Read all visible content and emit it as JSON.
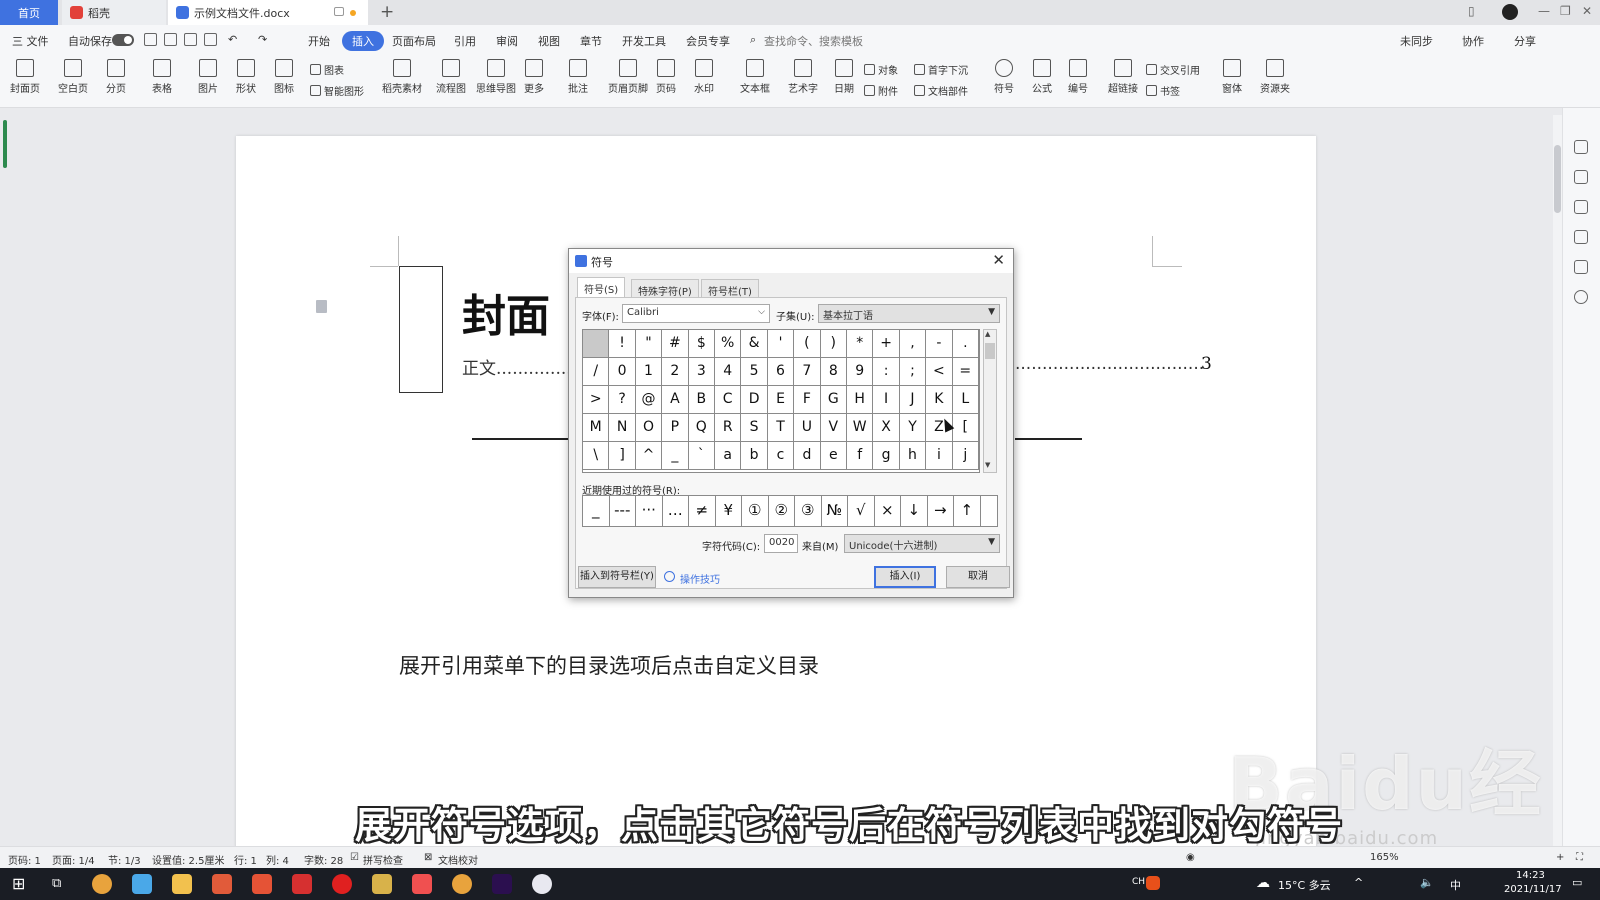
{
  "titlebar": {
    "tabs": [
      {
        "label": "首页"
      },
      {
        "label": "稻壳"
      },
      {
        "label": "示例文档文件.docx"
      }
    ],
    "new_tab": "+"
  },
  "menubar": {
    "file": "三 文件",
    "autosave": "自动保存",
    "items": [
      "开始",
      "插入",
      "页面布局",
      "引用",
      "审阅",
      "视图",
      "章节",
      "开发工具",
      "会员专享"
    ],
    "active": "插入",
    "search_placeholder": "查找命令、搜索模板",
    "right": [
      "未同步",
      "协作",
      "分享"
    ]
  },
  "ribbon": {
    "big": [
      {
        "label": "封面页"
      },
      {
        "label": "空白页"
      },
      {
        "label": "分页"
      },
      {
        "label": "表格"
      },
      {
        "label": "图片"
      },
      {
        "label": "形状"
      },
      {
        "label": "图标"
      },
      {
        "label": "稻壳素材"
      },
      {
        "label": "流程图"
      },
      {
        "label": "思维导图"
      },
      {
        "label": "更多"
      },
      {
        "label": "批注"
      },
      {
        "label": "页眉页脚"
      },
      {
        "label": "页码"
      },
      {
        "label": "水印"
      },
      {
        "label": "文本框"
      },
      {
        "label": "艺术字"
      },
      {
        "label": "日期"
      },
      {
        "label": "符号"
      },
      {
        "label": "公式"
      },
      {
        "label": "编号"
      },
      {
        "label": "超链接"
      },
      {
        "label": "窗体"
      },
      {
        "label": "资源夹"
      }
    ],
    "small": {
      "chart": "图表",
      "smart_shape": "智能图形",
      "object": "对象",
      "attachment": "附件",
      "dropcap": "首字下沉",
      "doc_parts": "文档部件",
      "crossref": "交叉引用",
      "bookmark": "书签"
    }
  },
  "document": {
    "cover_title": "封面",
    "toc_entry": "正文",
    "toc_dots_left": "..............",
    "toc_dots_right": "..........................................................................",
    "toc_page": "3",
    "body_text": "展开引用菜单下的目录选项后点击自定义目录"
  },
  "overlay": {
    "subtitle": "展开符号选项，点击其它符号后在符号列表中找到对勾符号",
    "watermark": "Baidu经验",
    "watermark_url": "jingyan.baidu.com"
  },
  "dialog": {
    "title": "符号",
    "tabs": [
      "符号(S)",
      "特殊字符(P)",
      "符号栏(T)"
    ],
    "font_label": "字体(F):",
    "font_value": "Calibri",
    "subset_label": "子集(U):",
    "subset_value": "基本拉丁语",
    "symbols": [
      " ",
      "!",
      "\"",
      "#",
      "$",
      "%",
      "&",
      "'",
      "(",
      ")",
      "*",
      "+",
      ",",
      "-",
      ".",
      "/",
      "0",
      "1",
      "2",
      "3",
      "4",
      "5",
      "6",
      "7",
      "8",
      "9",
      ":",
      ";",
      "<",
      "=",
      ">",
      "?",
      "@",
      "A",
      "B",
      "C",
      "D",
      "E",
      "F",
      "G",
      "H",
      "I",
      "J",
      "K",
      "L",
      "M",
      "N",
      "O",
      "P",
      "Q",
      "R",
      "S",
      "T",
      "U",
      "V",
      "W",
      "X",
      "Y",
      "Z",
      "[",
      "\\",
      "]",
      "^",
      "_",
      "`",
      "a",
      "b",
      "c",
      "d",
      "e",
      "f",
      "g",
      "h",
      "i",
      "j"
    ],
    "recent_label": "近期使用过的符号(R):",
    "recent": [
      "_",
      "---",
      "···",
      "…",
      "≠",
      "¥",
      "①",
      "②",
      "③",
      "№",
      "√",
      "×",
      "↓",
      "→",
      "↑"
    ],
    "code_label": "字符代码(C):",
    "code_value": "0020",
    "from_label": "来自(M)",
    "from_value": "Unicode(十六进制)",
    "add_to_bar": "插入到符号栏(Y)",
    "tips": "操作技巧",
    "insert": "插入(I)",
    "cancel": "取消"
  },
  "statusbar": {
    "items": [
      "页码: 1",
      "页面: 1/4",
      "节: 1/3",
      "设置值: 2.5厘米",
      "行: 1",
      "列: 4",
      "字数: 28",
      "拼写检查",
      "文档校对"
    ],
    "zoom": "165%"
  },
  "taskbar": {
    "weather": "15°C 多云",
    "ime": "中",
    "lang": "CH",
    "time": "14:23",
    "date": "2021/11/17"
  },
  "colors": {
    "accent": "#3f72e0",
    "taskbar": "#1a1d24"
  }
}
